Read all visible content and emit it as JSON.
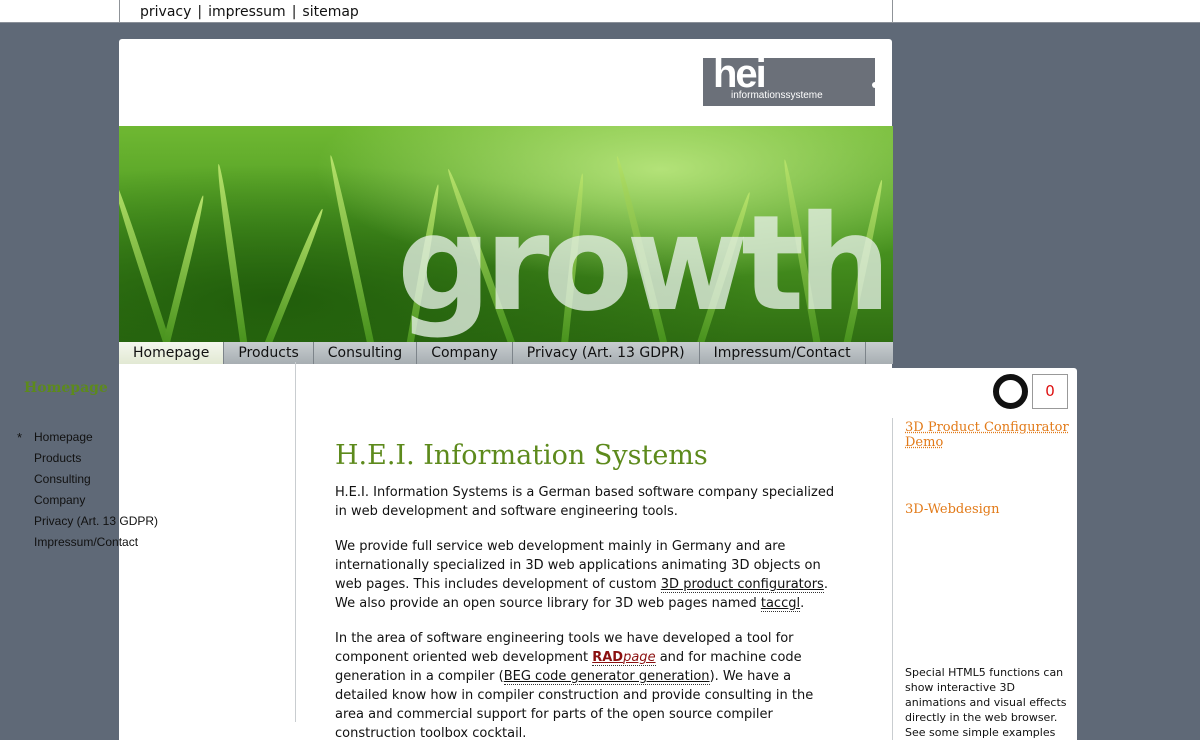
{
  "toplinks": {
    "privacy": "privacy",
    "sep": "|",
    "impressum": "impressum",
    "sitemap": "sitemap"
  },
  "logo": {
    "big": "hei",
    "small": "informationssysteme"
  },
  "banner": {
    "word": "growth"
  },
  "tabs": [
    {
      "label": "Homepage"
    },
    {
      "label": "Products"
    },
    {
      "label": "Consulting"
    },
    {
      "label": "Company"
    },
    {
      "label": "Privacy (Art. 13 GDPR)"
    },
    {
      "label": "Impressum/Contact"
    }
  ],
  "leftnav": {
    "title": "Homepage",
    "bullet": "*",
    "items": [
      {
        "label": "Homepage"
      },
      {
        "label": "Products"
      },
      {
        "label": "Consulting"
      },
      {
        "label": "Company"
      },
      {
        "label": "Privacy (Art. 13 GDPR)"
      },
      {
        "label": "Impressum/Contact"
      }
    ]
  },
  "content": {
    "title": "H.E.I. Information Systems",
    "p1": "H.E.I. Information Systems is a German based software company specialized in web development and software engineering tools.",
    "p2_a": "We provide full service web development mainly in Germany and are internationally specialized in 3D web applications animating 3D objects on web pages. This includes development of custom ",
    "p2_link1": "3D product configurators",
    "p2_b": ". We also provide an open source library for 3D web pages named ",
    "p2_link2": "taccgl",
    "p2_c": ".",
    "p3_a": "In the area of software engineering tools we have developed a tool for component oriented web development ",
    "p3_rad_bold": "RAD",
    "p3_rad_italic": "page",
    "p3_b": " and for machine code generation in a compiler (",
    "p3_link": "BEG code generator generation",
    "p3_c": "). We have a detailed know how in compiler construction and provide consulting in the area and commercial support for parts of the open source compiler construction toolbox cocktail."
  },
  "right": {
    "counter": "0",
    "link1": "3D Product Configurator Demo",
    "head2": "3D-Webdesign",
    "small": "Special HTML5 functions can show interactive 3D animations and visual effects directly in the web browser. See some simple examples"
  },
  "colors": {
    "background": "#5f6977",
    "accent_green": "#5d8a1c",
    "accent_orange": "#e27a18",
    "counter_red": "#dd1111"
  }
}
